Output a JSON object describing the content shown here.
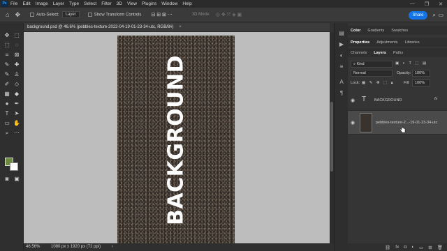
{
  "menubar": {
    "logo": "Ps",
    "items": [
      "File",
      "Edit",
      "Image",
      "Layer",
      "Type",
      "Select",
      "Filter",
      "3D",
      "View",
      "Plugins",
      "Window",
      "Help"
    ],
    "window_controls": [
      "—",
      "❐",
      "✕"
    ]
  },
  "options": {
    "auto_select_label": "Auto-Select:",
    "auto_select_target": "Layer",
    "show_transform_label": "Show Transform Controls",
    "mode_3d_label": "3D Mode:",
    "share_label": "Share"
  },
  "document": {
    "tab_title": "background.psd @ 46.6% (pebbles-texture-2022-04-19-01-23-34-utc, RGB/8#)",
    "close_glyph": "×",
    "canvas_text": "BACKGROUND"
  },
  "status": {
    "zoom": "46.56%",
    "doc_size": "1080 px x 1920 px (72 ppi)"
  },
  "colors": {
    "foreground": "#6a8a3c",
    "background": "#ffffff",
    "accent": "#1473e6"
  },
  "panels": {
    "top_tabs": [
      "Color",
      "Gradients",
      "Swatches"
    ],
    "mid_tabs": [
      "Properties",
      "Adjustments",
      "Libraries"
    ],
    "layer_tabs": [
      "Channels",
      "Layers",
      "Paths"
    ],
    "filter_kind": "Kind",
    "blend_mode": "Normal",
    "opacity_label": "Opacity:",
    "opacity_value": "100%",
    "lock_label": "Lock:",
    "fill_label": "Fill:",
    "fill_value": "100%",
    "layers": [
      {
        "name": "BACKGROUND",
        "type": "text",
        "fx": "fx"
      },
      {
        "name": "pebbles-texture-2...-19-01-23-34-utc",
        "type": "image"
      }
    ]
  }
}
